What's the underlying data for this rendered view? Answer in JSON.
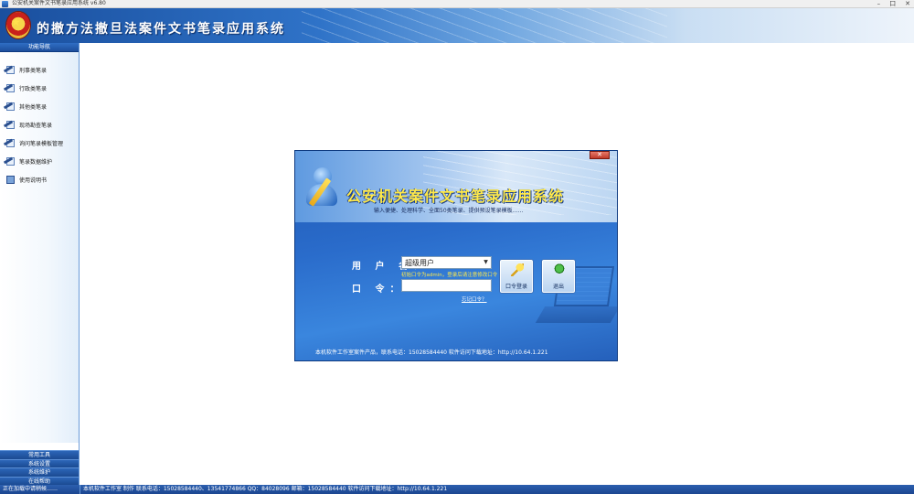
{
  "window": {
    "title": "公安机关案件文书笔录应用系统 v6.80",
    "controls": [
      "–",
      "口",
      "✕"
    ]
  },
  "banner": {
    "title": "的撤方法撤旦法案件文书笔录应用系统"
  },
  "sidebar": {
    "header": "功能导航",
    "items": [
      {
        "label": "刑事类笔录",
        "icon": "pen-page-icon"
      },
      {
        "label": "行政类笔录",
        "icon": "pen-page-icon"
      },
      {
        "label": "其他类笔录",
        "icon": "pen-page-icon"
      },
      {
        "label": "现场勘查笔录",
        "icon": "pen-page-icon"
      },
      {
        "label": "询问笔录模板管理",
        "icon": "pen-page-icon"
      },
      {
        "label": "笔录数据维护",
        "icon": "pen-page-icon"
      },
      {
        "label": "使用说明书",
        "icon": "book-icon"
      }
    ],
    "bottom_buttons": [
      "常用工具",
      "系统设置",
      "系统维护",
      "在线帮助"
    ]
  },
  "dialog": {
    "close_label": "✕",
    "title": "公安机关案件文书笔录应用系统",
    "subtitle": "输入便捷、处理科学、全面50类笔录、提供预设笔录模板……",
    "user_label": "用 户 名：",
    "password_label": "口 令：",
    "user_value": "超级用户",
    "hint": "初始口令为admin，登录后请注意修改口令",
    "password_value": "",
    "forgot_link": "忘记口令？",
    "login_button": "口令登录",
    "exit_button": "退出",
    "footer": "本机软件工作室案件产品，联系电话：15028584440 软件访问下载地址：http://10.64.1.221"
  },
  "status": {
    "left": "正在加载中请稍候……",
    "right": "本机软件工作室 制作 联系电话：15028584440、13541774866 QQ：84028096 邮箱：15028584440 软件访问下载地址：http://10.64.1.221"
  }
}
